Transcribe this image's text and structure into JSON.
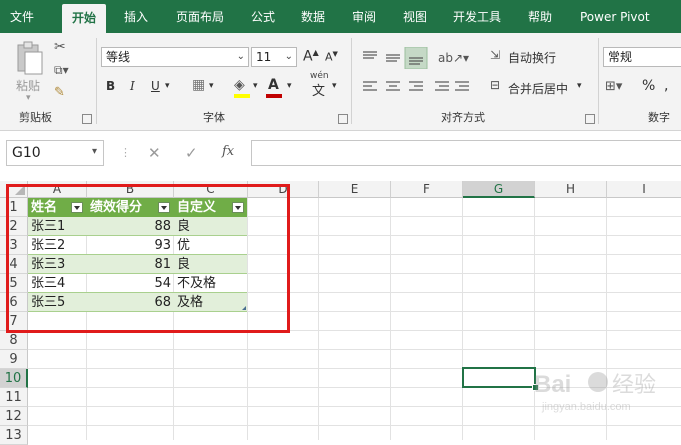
{
  "tabs": [
    "文件",
    "开始",
    "插入",
    "页面布局",
    "公式",
    "数据",
    "审阅",
    "视图",
    "开发工具",
    "帮助",
    "Power Pivot"
  ],
  "ribbon": {
    "clipboard": {
      "paste_label": "粘贴",
      "group_label": "剪贴板"
    },
    "font": {
      "font_name": "等线",
      "font_size": "11",
      "grow": "A",
      "shrink": "A",
      "bold": "B",
      "italic": "I",
      "underline": "U",
      "group_label": "字体",
      "font_color": "#c00000",
      "fill_color": "#ffff00",
      "phonetic": "wén"
    },
    "alignment": {
      "wrap_label": "自动换行",
      "merge_label": "合并后居中",
      "group_label": "对齐方式"
    },
    "number": {
      "format": "常规",
      "percent": "%",
      "group_label": "数字"
    }
  },
  "formula_bar": {
    "name_box": "G10",
    "fx_label": "fx",
    "value": ""
  },
  "columns": [
    "A",
    "B",
    "C",
    "D",
    "E",
    "F",
    "G",
    "H",
    "I"
  ],
  "rows": [
    "1",
    "2",
    "3",
    "4",
    "5",
    "6",
    "7",
    "8",
    "9",
    "10",
    "11",
    "12",
    "13"
  ],
  "table": {
    "headers": [
      "姓名",
      "绩效得分",
      "自定义"
    ],
    "rows": [
      [
        "张三1",
        "88",
        "良"
      ],
      [
        "张三2",
        "93",
        "优"
      ],
      [
        "张三3",
        "81",
        "良"
      ],
      [
        "张三4",
        "54",
        "不及格"
      ],
      [
        "张三5",
        "68",
        "及格"
      ]
    ]
  },
  "active_cell": "G10",
  "colors": {
    "accent": "#217346",
    "table_header": "#70ad47",
    "band": "#e2efda",
    "highlight": "#e01b1b"
  },
  "watermark": {
    "brand": "Baidu经验",
    "url": "jingyan.baidu.com"
  }
}
